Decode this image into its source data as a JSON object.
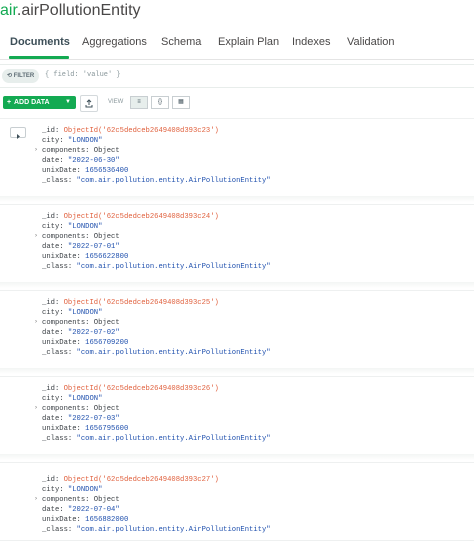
{
  "header": {
    "db_prefix": "air",
    "collection": ".airPollutionEntity"
  },
  "tabs": [
    {
      "label": "Documents"
    },
    {
      "label": "Aggregations"
    },
    {
      "label": "Schema"
    },
    {
      "label": "Explain Plan"
    },
    {
      "label": "Indexes"
    },
    {
      "label": "Validation"
    }
  ],
  "filter": {
    "pill_label": "FILTER",
    "placeholder": "{ field: 'value' }"
  },
  "toolbar": {
    "add_data_label": "ADD DATA",
    "view_label": "VIEW",
    "list_icon": "≡",
    "json_icon": "{}",
    "table_icon": "▦"
  },
  "documents": [
    {
      "id_label": "_id:",
      "id_value": "ObjectId('62c5dedceb2649408d393c23')",
      "city_label": "city:",
      "city_value": "\"LONDON\"",
      "components_label": "components:",
      "components_value": "Object",
      "date_label": "date:",
      "date_value": "\"2022-06-30\"",
      "unix_label": "unixDate:",
      "unix_value": "1656536400",
      "class_label": "_class:",
      "class_value": "\"com.air.pollution.entity.AirPollutionEntity\""
    },
    {
      "id_label": "_id:",
      "id_value": "ObjectId('62c5dedceb2649408d393c24')",
      "city_label": "city:",
      "city_value": "\"LONDON\"",
      "components_label": "components:",
      "components_value": "Object",
      "date_label": "date:",
      "date_value": "\"2022-07-01\"",
      "unix_label": "unixDate:",
      "unix_value": "1656622800",
      "class_label": "_class:",
      "class_value": "\"com.air.pollution.entity.AirPollutionEntity\""
    },
    {
      "id_label": "_id:",
      "id_value": "ObjectId('62c5dedceb2649408d393c25')",
      "city_label": "city:",
      "city_value": "\"LONDON\"",
      "components_label": "components:",
      "components_value": "Object",
      "date_label": "date:",
      "date_value": "\"2022-07-02\"",
      "unix_label": "unixDate:",
      "unix_value": "1656709200",
      "class_label": "_class:",
      "class_value": "\"com.air.pollution.entity.AirPollutionEntity\""
    },
    {
      "id_label": "_id:",
      "id_value": "ObjectId('62c5dedceb2649408d393c26')",
      "city_label": "city:",
      "city_value": "\"LONDON\"",
      "components_label": "components:",
      "components_value": "Object",
      "date_label": "date:",
      "date_value": "\"2022-07-03\"",
      "unix_label": "unixDate:",
      "unix_value": "1656795600",
      "class_label": "_class:",
      "class_value": "\"com.air.pollution.entity.AirPollutionEntity\""
    },
    {
      "id_label": "_id:",
      "id_value": "ObjectId('62c5dedceb2649408d393c27')",
      "city_label": "city:",
      "city_value": "\"LONDON\"",
      "components_label": "components:",
      "components_value": "Object",
      "date_label": "date:",
      "date_value": "\"2022-07-04\"",
      "unix_label": "unixDate:",
      "unix_value": "1656882000",
      "class_label": "_class:",
      "class_value": "\"com.air.pollution.entity.AirPollutionEntity\""
    }
  ]
}
